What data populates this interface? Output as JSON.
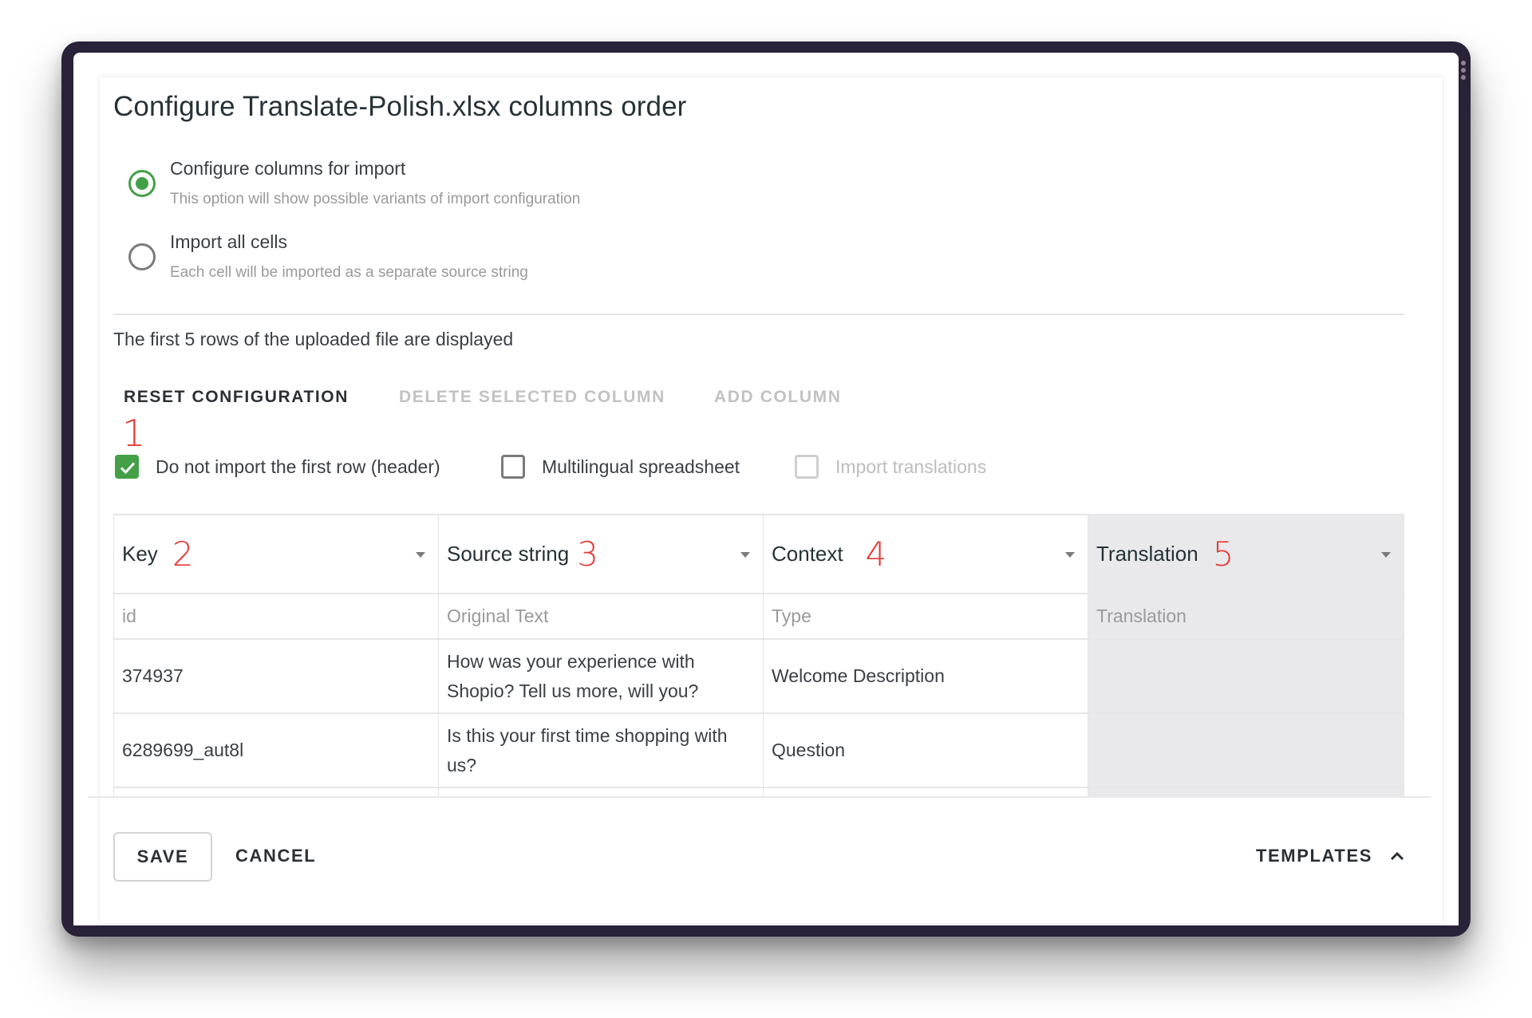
{
  "dialog": {
    "title": "Configure Translate-Polish.xlsx columns order",
    "import_mode": {
      "options": [
        {
          "label": "Configure columns for import",
          "description": "This option will show possible variants of import configuration",
          "selected": true
        },
        {
          "label": "Import all cells",
          "description": "Each cell will be imported as a separate source string",
          "selected": false
        }
      ]
    },
    "preview_info": "The first 5 rows of the uploaded file are displayed",
    "toolbar": {
      "reset_label": "RESET CONFIGURATION",
      "delete_label": "DELETE SELECTED COLUMN",
      "add_label": "ADD COLUMN",
      "reset_enabled": true,
      "delete_enabled": false,
      "add_enabled": false
    },
    "options": [
      {
        "label": "Do not import the first row (header)",
        "checked": true,
        "enabled": true
      },
      {
        "label": "Multilingual spreadsheet",
        "checked": false,
        "enabled": true
      },
      {
        "label": "Import translations",
        "checked": false,
        "enabled": false
      }
    ],
    "annotations": [
      "1",
      "2",
      "3",
      "4",
      "5"
    ],
    "table": {
      "columns": [
        {
          "label": "Key",
          "annotation": "2",
          "header_value": "id",
          "selected": false
        },
        {
          "label": "Source string",
          "annotation": "3",
          "header_value": "Original Text",
          "selected": false
        },
        {
          "label": "Context",
          "annotation": "4",
          "header_value": "Type",
          "selected": false
        },
        {
          "label": "Translation",
          "annotation": "5",
          "header_value": "Translation",
          "selected": true
        }
      ],
      "rows": [
        [
          "374937",
          "How was your experience with Shopio? Tell us more, will you?",
          "Welcome Description",
          ""
        ],
        [
          "6289699_aut8l",
          "Is this your first time shopping with us?",
          "Question",
          ""
        ]
      ]
    },
    "footer": {
      "save_label": "SAVE",
      "cancel_label": "CANCEL",
      "templates_label": "TEMPLATES"
    }
  },
  "colors": {
    "accent_green": "#43a047",
    "annotation_red": "#e53935",
    "selected_column_bg": "#e9e9eb",
    "frame": "#2a2238"
  }
}
